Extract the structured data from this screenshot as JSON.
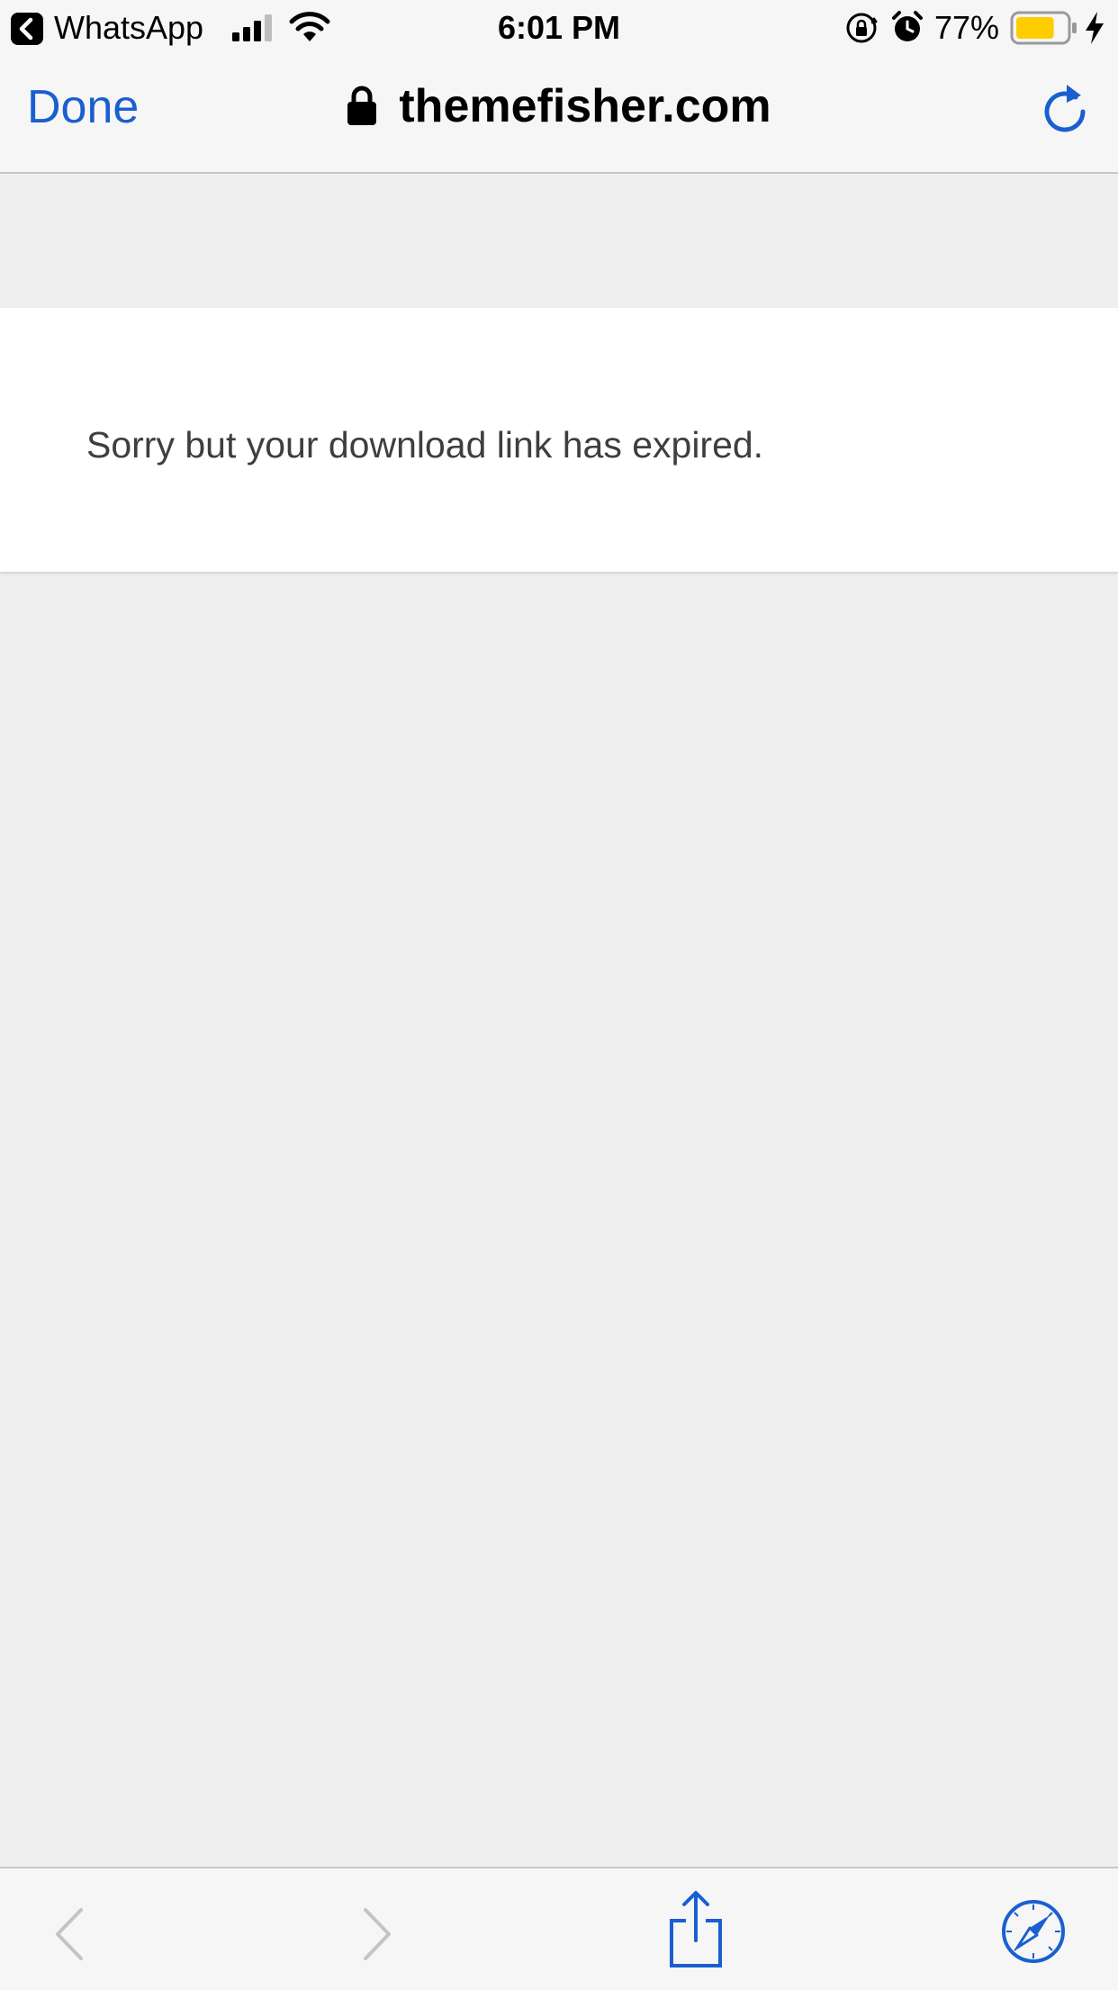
{
  "status_bar": {
    "back_app": "WhatsApp",
    "time": "6:01 PM",
    "battery_percent": "77%",
    "battery_level": 0.77,
    "battery_color": "#ffcc00",
    "icons": [
      "chevron-left-icon",
      "signal-icon",
      "wifi-icon",
      "orientation-lock-icon",
      "alarm-icon",
      "battery-icon",
      "charging-bolt-icon"
    ]
  },
  "nav": {
    "done_label": "Done",
    "url": "themefisher.com",
    "icons": [
      "lock-icon",
      "reload-icon"
    ],
    "accent_color": "#1a5fd0"
  },
  "page": {
    "message": "Sorry but your download link has expired."
  },
  "toolbar": {
    "icons": [
      "back-arrow-icon",
      "forward-arrow-icon",
      "share-icon",
      "safari-compass-icon"
    ],
    "back_enabled": false,
    "forward_enabled": false
  }
}
